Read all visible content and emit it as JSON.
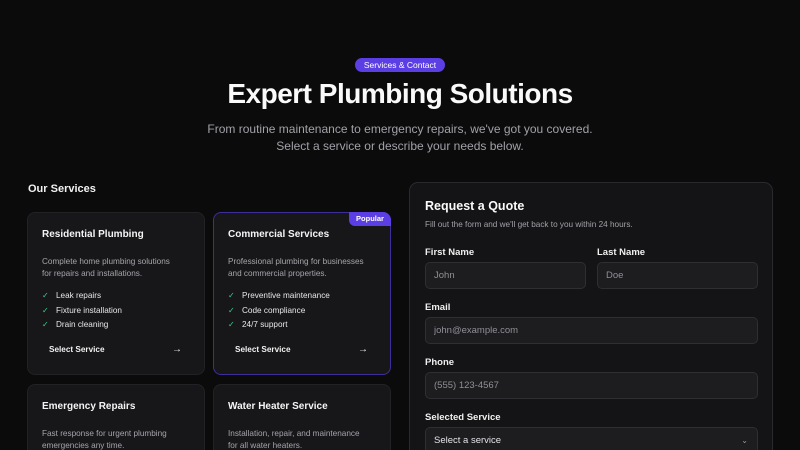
{
  "hero": {
    "badge": "Services & Contact",
    "title": "Expert Plumbing Solutions",
    "subtitle_line1": "From routine maintenance to emergency repairs, we've got you covered.",
    "subtitle_line2": "Select a service or describe your needs below."
  },
  "services": {
    "heading": "Our Services",
    "select_label": "Select Service",
    "cards": [
      {
        "title": "Residential Plumbing",
        "desc_line1": "Complete home plumbing solutions",
        "desc_line2": "for repairs and installations.",
        "features": [
          "Leak repairs",
          "Fixture installation",
          "Drain cleaning"
        ]
      },
      {
        "title": "Commercial Services",
        "badge": "Popular",
        "desc_line1": "Professional plumbing for businesses",
        "desc_line2": "and commercial properties.",
        "features": [
          "Preventive maintenance",
          "Code compliance",
          "24/7 support"
        ]
      },
      {
        "title": "Emergency Repairs",
        "desc_line1": "Fast response for urgent plumbing",
        "desc_line2": "emergencies any time."
      },
      {
        "title": "Water Heater Service",
        "desc_line1": "Installation, repair, and maintenance",
        "desc_line2": "for all water heaters."
      }
    ]
  },
  "form": {
    "title": "Request a Quote",
    "subtitle": "Fill out the form and we'll get back to you within 24 hours.",
    "first_name_label": "First Name",
    "first_name_placeholder": "John",
    "last_name_label": "Last Name",
    "last_name_placeholder": "Doe",
    "email_label": "Email",
    "email_placeholder": "john@example.com",
    "phone_label": "Phone",
    "phone_placeholder": "(555) 123-4567",
    "service_label": "Selected Service",
    "service_value": "Select a service"
  },
  "icons": {
    "check": "check-icon",
    "arrow": "arrow-right-icon",
    "chevron": "chevron-down-icon"
  },
  "colors": {
    "accent": "#5b3fe4",
    "check": "#3ecf8e",
    "background": "#0b0b0c",
    "card": "#17171a"
  }
}
